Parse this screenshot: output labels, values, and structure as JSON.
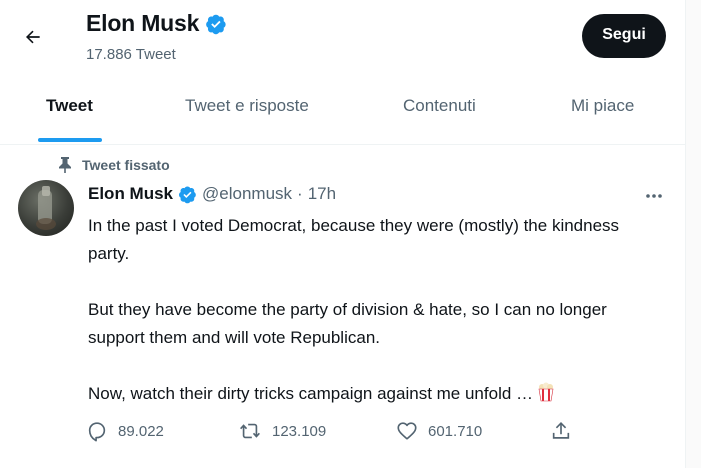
{
  "header": {
    "back_label": "Back",
    "title": "Elon Musk",
    "tweet_count": "17.886 Tweet",
    "follow_label": "Segui"
  },
  "tabs": [
    {
      "label": "Tweet",
      "active": true
    },
    {
      "label": "Tweet e risposte",
      "active": false
    },
    {
      "label": "Contenuti",
      "active": false
    },
    {
      "label": "Mi piace",
      "active": false
    }
  ],
  "tweet": {
    "pinned_label": "Tweet fissato",
    "author_name": "Elon Musk",
    "handle": "@elonmusk",
    "separator": "·",
    "time": "17h",
    "paragraphs": [
      "In the past I voted Democrat, because they were (mostly) the kindness party.",
      "But they have become the party of division & hate, so I can no longer support them and will vote Republican.",
      "Now, watch their dirty tricks campaign against me unfold …"
    ],
    "actions": {
      "replies": "89.022",
      "retweets": "123.109",
      "likes": "601.710"
    }
  },
  "colors": {
    "accent": "#1d9bf0",
    "text": "#0f1419",
    "muted": "#536471",
    "verified": "#1d9bf0"
  },
  "icons": [
    "back-arrow-icon",
    "verified-badge-icon",
    "pin-icon",
    "more-icon",
    "popcorn-icon",
    "reply-icon",
    "retweet-icon",
    "like-icon",
    "share-icon"
  ]
}
